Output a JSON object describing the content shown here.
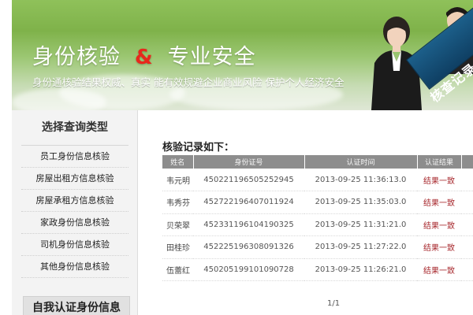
{
  "banner": {
    "title_left": "身份核验",
    "title_amp": "&",
    "title_right": "专业安全",
    "subtitle": "身份通核验结果权威、真实   能有效规避企业商业风险   保护个人经济安全",
    "badge": "核查记录"
  },
  "sidebar": {
    "title": "选择查询类型",
    "items": [
      {
        "label": "员工身份信息核验"
      },
      {
        "label": "房屋出租方信息核验"
      },
      {
        "label": "房屋承租方信息核验"
      },
      {
        "label": "家政身份信息核验"
      },
      {
        "label": "司机身份信息核验"
      },
      {
        "label": "其他身份信息核验"
      }
    ],
    "footer": "自我认证身份信息"
  },
  "main": {
    "title": "核验记录如下：",
    "columns": [
      "姓名",
      "身份证号",
      "认证时间",
      "认证结果"
    ],
    "rows": [
      {
        "name": "韦元明",
        "id": "450221196505252945",
        "time": "2013-09-25 11:36:13.0",
        "result": "结果一致"
      },
      {
        "name": "韦秀芬",
        "id": "452722196407011924",
        "time": "2013-09-25 11:35:03.0",
        "result": "结果一致"
      },
      {
        "name": "贝荣翠",
        "id": "452331196104190325",
        "time": "2013-09-25 11:31:21.0",
        "result": "结果一致"
      },
      {
        "name": "田桂珍",
        "id": "452225196308091326",
        "time": "2013-09-25 11:27:22.0",
        "result": "结果一致"
      },
      {
        "name": "伍蕾红",
        "id": "450205199101090728",
        "time": "2013-09-25 11:26:21.0",
        "result": "结果一致"
      }
    ],
    "pager": "1/1"
  },
  "colors": {
    "banner_green": "#7fb24a",
    "header_gray": "#8d8d8d",
    "result_red": "#a6252a",
    "ribbon_blue": "#1c5f8a"
  }
}
